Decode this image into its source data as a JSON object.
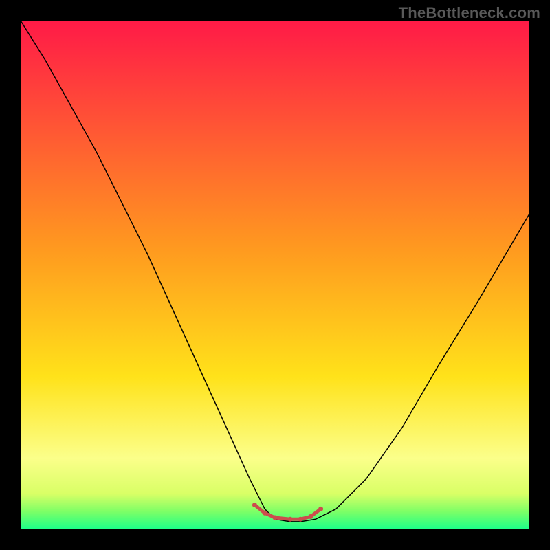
{
  "watermark": "TheBottleneck.com",
  "chart_data": {
    "type": "line",
    "title": "",
    "xlabel": "",
    "ylabel": "",
    "xlim": [
      0,
      100
    ],
    "ylim": [
      0,
      100
    ],
    "grid": false,
    "legend": false,
    "background_gradient": {
      "stops": [
        {
          "offset": 0.0,
          "color": "#ff1a47"
        },
        {
          "offset": 0.45,
          "color": "#ff9a1f"
        },
        {
          "offset": 0.7,
          "color": "#ffe21a"
        },
        {
          "offset": 0.86,
          "color": "#fbff8a"
        },
        {
          "offset": 0.93,
          "color": "#d9ff66"
        },
        {
          "offset": 0.965,
          "color": "#7dff66"
        },
        {
          "offset": 1.0,
          "color": "#1aff8a"
        }
      ]
    },
    "series": [
      {
        "name": "bottleneck-curve",
        "color": "#000000",
        "stroke_width": 1.5,
        "x": [
          0,
          5,
          10,
          15,
          20,
          25,
          30,
          35,
          40,
          45,
          48,
          50,
          53,
          55,
          58,
          62,
          68,
          75,
          82,
          90,
          100
        ],
        "y": [
          100,
          92,
          83,
          74,
          64,
          54,
          43,
          32,
          21,
          10,
          4,
          2,
          1.5,
          1.5,
          2,
          4,
          10,
          20,
          32,
          45,
          62
        ]
      },
      {
        "name": "optimal-zone-marker",
        "color": "#cc4d4d",
        "stroke_width": 5,
        "x": [
          46,
          48,
          50,
          53,
          55,
          57,
          59
        ],
        "y": [
          4.8,
          3.2,
          2.3,
          2.0,
          2.0,
          2.5,
          4.0
        ],
        "markers": true,
        "marker_radius": 3.5
      }
    ]
  }
}
